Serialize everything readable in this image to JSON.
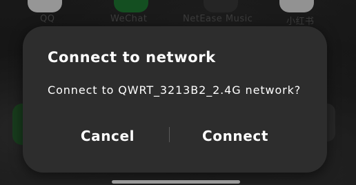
{
  "home_screen": {
    "apps": [
      {
        "label": "QQ",
        "icon": "qq-icon",
        "color": "#e8e8e8"
      },
      {
        "label": "WeChat",
        "icon": "wechat-icon",
        "color": "#1f8a3a"
      },
      {
        "label": "NetEase Music",
        "icon": "music-icon",
        "color": "#333333"
      },
      {
        "label": "小红书",
        "icon": "app-icon",
        "color": "#e6e6e6"
      }
    ]
  },
  "dialog": {
    "title": "Connect to network",
    "message": "Connect to QWRT_3213B2_2.4G network?",
    "cancel_label": "Cancel",
    "connect_label": "Connect"
  },
  "colors": {
    "dialog_background": "#2d2d2d",
    "text": "#ffffff"
  }
}
